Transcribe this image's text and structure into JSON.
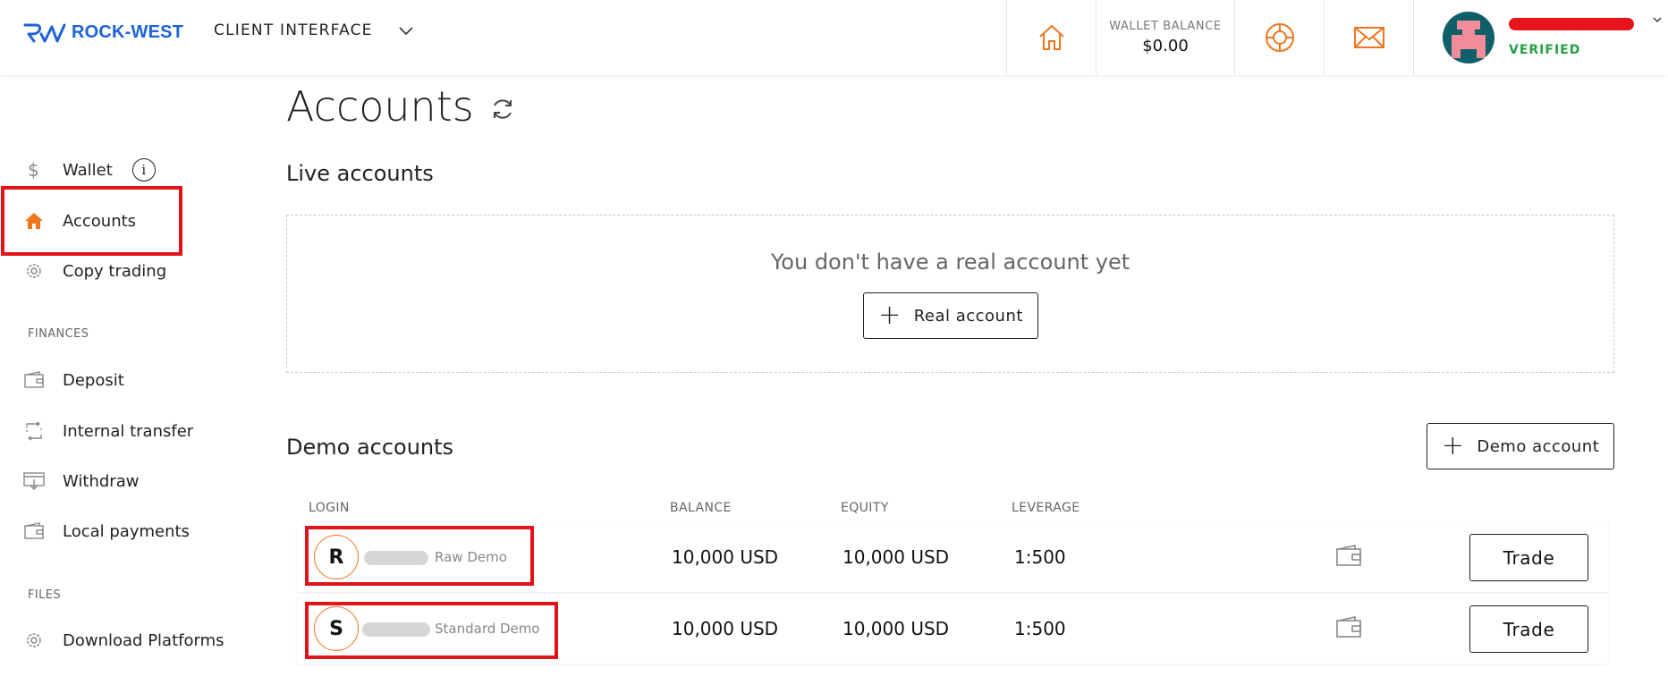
{
  "brand": {
    "name": "ROCK-WEST"
  },
  "header": {
    "client_interface_label": "CLIENT INTERFACE",
    "wallet_balance_label": "WALLET BALANCE",
    "wallet_balance_value": "$0.00",
    "user_status": "VERIFIED",
    "icons": [
      "home-icon",
      "lifebuoy-icon",
      "mail-icon",
      "avatar",
      "chevron-down-icon"
    ]
  },
  "sidebar": {
    "items": [
      {
        "label": "Wallet",
        "icon": "dollar-icon"
      },
      {
        "label": "Accounts",
        "icon": "home-icon",
        "active": true
      },
      {
        "label": "Copy trading",
        "icon": "gear-icon"
      }
    ],
    "finances_label": "FINANCES",
    "finances_items": [
      {
        "label": "Deposit",
        "icon": "wallet-icon"
      },
      {
        "label": "Internal transfer",
        "icon": "transfer-icon"
      },
      {
        "label": "Withdraw",
        "icon": "withdraw-icon"
      },
      {
        "label": "Local payments",
        "icon": "wallet-icon"
      }
    ],
    "files_label": "FILES",
    "files_items": [
      {
        "label": "Download Platforms",
        "icon": "gear-icon"
      }
    ]
  },
  "main": {
    "title": "Accounts",
    "live_title": "Live accounts",
    "live_empty_text": "You don't have a real account yet",
    "real_account_button": "Real account",
    "demo_title": "Demo accounts",
    "demo_account_button": "Demo account",
    "columns": [
      "LOGIN",
      "BALANCE",
      "EQUITY",
      "LEVERAGE"
    ],
    "rows": [
      {
        "initial": "R",
        "type": "Raw Demo",
        "balance": "10,000 USD",
        "equity": "10,000 USD",
        "leverage": "1:500",
        "action": "Trade"
      },
      {
        "initial": "S",
        "type": "Standard Demo",
        "balance": "10,000 USD",
        "equity": "10,000 USD",
        "leverage": "1:500",
        "action": "Trade"
      }
    ]
  },
  "colors": {
    "accent_orange": "#f0761e",
    "brand_blue": "#1e63d8",
    "verified_green": "#22a045",
    "highlight_red": "#e0141a"
  }
}
